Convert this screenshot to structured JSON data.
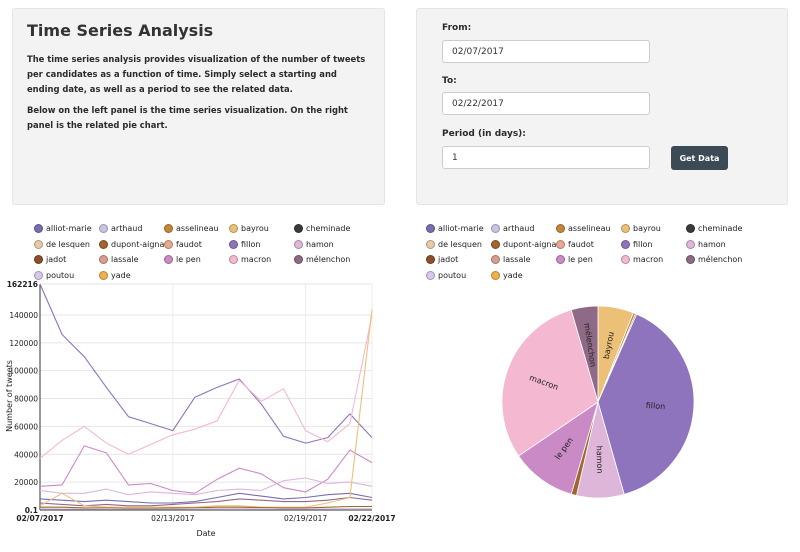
{
  "info": {
    "title": "Time Series Analysis",
    "paragraph1": "The time series analysis provides visualization of the number of tweets per candidates as a function of time. Simply select a starting and ending date, as well as a period to see the related data.",
    "paragraph2": "Below on the left panel is the time series visualization. On the right panel is the related pie chart."
  },
  "form": {
    "from_label": "From:",
    "from_value": "02/07/2017",
    "to_label": "To:",
    "to_value": "02/22/2017",
    "period_label": "Period (in days):",
    "period_value": "1",
    "button_label": "Get Data"
  },
  "candidates": [
    {
      "name": "alliot-marie",
      "color": "#7b6bb0"
    },
    {
      "name": "arthaud",
      "color": "#c9c3e6"
    },
    {
      "name": "asselineau",
      "color": "#c3873a"
    },
    {
      "name": "bayrou",
      "color": "#edc078"
    },
    {
      "name": "cheminade",
      "color": "#3a3a3a"
    },
    {
      "name": "de lesquen",
      "color": "#e8c9a8"
    },
    {
      "name": "dupont-aignan",
      "color": "#a1652e"
    },
    {
      "name": "faudot",
      "color": "#e8a98e"
    },
    {
      "name": "fillon",
      "color": "#8e74bd"
    },
    {
      "name": "hamon",
      "color": "#ddb6da"
    },
    {
      "name": "jadot",
      "color": "#8a4f2a"
    },
    {
      "name": "lassale",
      "color": "#d79d8e"
    },
    {
      "name": "le pen",
      "color": "#c98ac6"
    },
    {
      "name": "macron",
      "color": "#f4b8d1"
    },
    {
      "name": "mélenchon",
      "color": "#8f6a86"
    },
    {
      "name": "poutou",
      "color": "#d6c8e8"
    },
    {
      "name": "yade",
      "color": "#f0b04a"
    }
  ],
  "chart_data": [
    {
      "type": "line",
      "xlabel": "Date",
      "ylabel": "Number of tweets",
      "x": [
        "02/07/2017",
        "02/08/2017",
        "02/09/2017",
        "02/10/2017",
        "02/11/2017",
        "02/12/2017",
        "02/13/2017",
        "02/14/2017",
        "02/15/2017",
        "02/16/2017",
        "02/17/2017",
        "02/18/2017",
        "02/19/2017",
        "02/20/2017",
        "02/21/2017",
        "02/22/2017"
      ],
      "x_tick_labels": [
        "02/07/2017",
        "02/13/2017",
        "02/19/2017",
        "02/22/2017"
      ],
      "y_tick_labels": [
        "0.1",
        "20000",
        "40000",
        "60000",
        "80000",
        "100000",
        "120000",
        "140000",
        "162216"
      ],
      "ylim": [
        0.1,
        162216
      ],
      "series": [
        {
          "name": "fillon",
          "values": [
            162216,
            126000,
            110000,
            88000,
            67000,
            62000,
            57000,
            81000,
            88000,
            94000,
            76000,
            53000,
            48000,
            52000,
            69000,
            52000
          ]
        },
        {
          "name": "macron",
          "values": [
            37000,
            50000,
            60000,
            48000,
            40000,
            47000,
            54000,
            58000,
            64000,
            93000,
            78000,
            87000,
            57000,
            49000,
            62000,
            140000
          ]
        },
        {
          "name": "le pen",
          "values": [
            17000,
            18000,
            46000,
            41000,
            18000,
            19000,
            14000,
            12000,
            22000,
            30000,
            26000,
            16000,
            13000,
            22000,
            43000,
            34000
          ]
        },
        {
          "name": "hamon",
          "values": [
            14000,
            12000,
            12000,
            15000,
            11000,
            13000,
            12000,
            11000,
            14000,
            15000,
            14000,
            21000,
            23000,
            19000,
            20000,
            17000
          ]
        },
        {
          "name": "mélenchon",
          "values": [
            5000,
            4000,
            3000,
            4000,
            3000,
            3000,
            4000,
            5000,
            6000,
            8000,
            7000,
            6000,
            6000,
            7000,
            9000,
            7000
          ]
        },
        {
          "name": "alliot-marie",
          "values": [
            8000,
            7000,
            6000,
            7000,
            6000,
            5000,
            5000,
            6000,
            9000,
            12000,
            10000,
            8000,
            9000,
            11000,
            12000,
            9000
          ]
        },
        {
          "name": "bayrou",
          "values": [
            3000,
            12000,
            3000,
            2000,
            2000,
            2000,
            2000,
            2000,
            3000,
            3000,
            2000,
            2000,
            2000,
            5000,
            9000,
            144000
          ]
        },
        {
          "name": "dupont-aignan",
          "values": [
            2000,
            2000,
            1500,
            1500,
            1200,
            1200,
            1500,
            1500,
            2000,
            2000,
            1800,
            1500,
            1500,
            2000,
            2500,
            2500
          ]
        },
        {
          "name": "poutou",
          "values": [
            1000,
            800,
            800,
            900,
            700,
            700,
            800,
            900,
            1000,
            1100,
            900,
            800,
            800,
            900,
            1100,
            1000
          ]
        }
      ]
    },
    {
      "type": "pie",
      "slice_labels": [
        "bayrou",
        "fillon",
        "hamon",
        "le pen",
        "macron",
        "mélenchon"
      ],
      "slices": [
        {
          "name": "bayrou",
          "value": 6.0
        },
        {
          "name": "asselineau",
          "value": 0.4
        },
        {
          "name": "cheminade",
          "value": 0.2
        },
        {
          "name": "fillon",
          "value": 39.0
        },
        {
          "name": "hamon",
          "value": 8.0
        },
        {
          "name": "dupont-aignan",
          "value": 0.9
        },
        {
          "name": "le pen",
          "value": 11.0
        },
        {
          "name": "macron",
          "value": 30.0
        },
        {
          "name": "mélenchon",
          "value": 4.5
        }
      ]
    }
  ]
}
